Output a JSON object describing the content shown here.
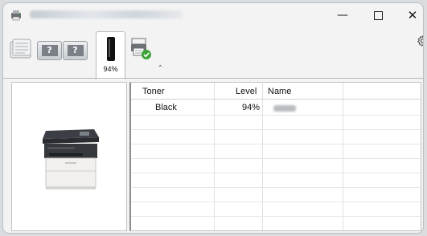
{
  "window": {
    "title_redacted": true,
    "minimize_glyph": "—",
    "close_glyph": "✕"
  },
  "toolbar": {
    "tabs": [
      {
        "name": "status-tab-icon"
      },
      {
        "name": "help-tab-1",
        "glyph": "?"
      },
      {
        "name": "help-tab-2",
        "glyph": "?"
      },
      {
        "name": "toner-tab",
        "label": "94%"
      },
      {
        "name": "printer-ok-tab-icon"
      }
    ],
    "collapse_glyph": "⌃",
    "settings_icon": "gear-icon"
  },
  "toner_table": {
    "headers": [
      "Toner",
      "Level",
      "Name"
    ],
    "rows": [
      {
        "toner": "Black",
        "level": "94%",
        "name_redacted": true
      }
    ]
  },
  "colors": {
    "window_bg": "#f3f3f3",
    "pane_bg": "#ffffff",
    "accent_check": "#3aa335"
  }
}
